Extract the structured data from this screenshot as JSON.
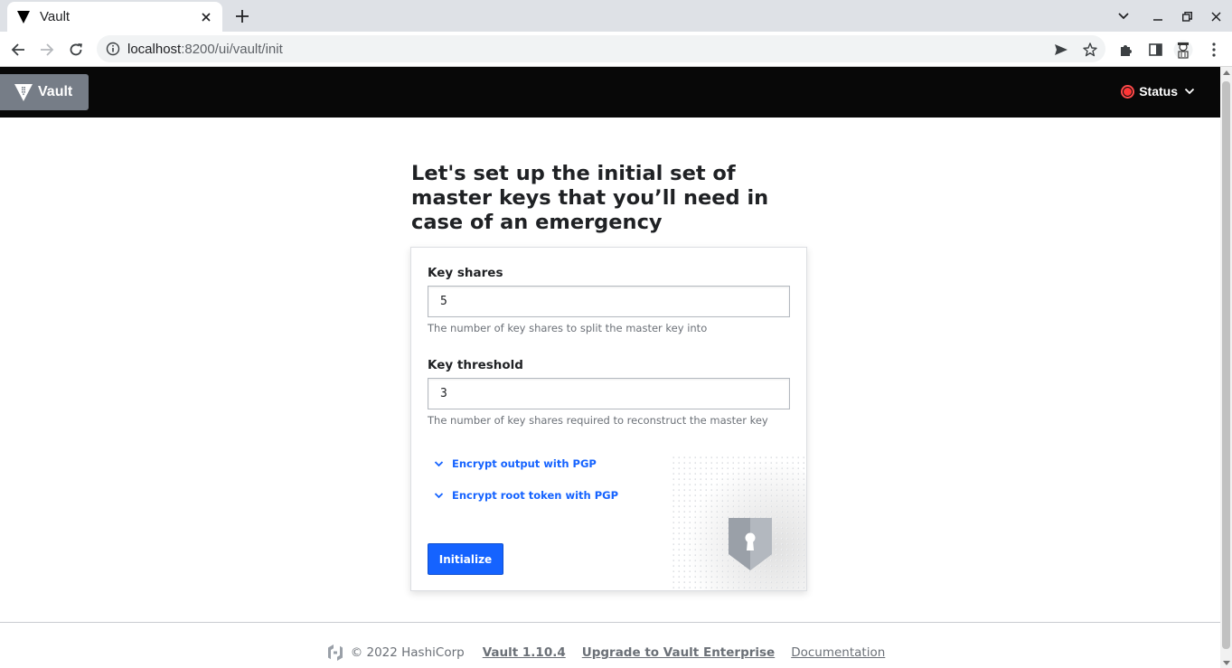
{
  "browser": {
    "tab_title": "Vault",
    "url_host": "localhost",
    "url_rest": ":8200/ui/vault/init"
  },
  "header": {
    "brand": "Vault",
    "status_label": "Status",
    "status_color": "#ff3535"
  },
  "page": {
    "heading": "Let's set up the initial set of master keys that you’ll need in case of an emergency"
  },
  "form": {
    "key_shares_label": "Key shares",
    "key_shares_value": "5",
    "key_shares_help": "The number of key shares to split the master key into",
    "key_threshold_label": "Key threshold",
    "key_threshold_value": "3",
    "key_threshold_help": "The number of key shares required to reconstruct the master key",
    "pgp_output_toggle": "Encrypt output with PGP",
    "pgp_root_toggle": "Encrypt root token with PGP",
    "submit_label": "Initialize",
    "accent_color": "#1563ff"
  },
  "footer": {
    "copyright": "© 2022 HashiCorp",
    "version_link": "Vault 1.10.4",
    "upgrade_link": "Upgrade to Vault Enterprise",
    "docs_link": "Documentation"
  }
}
